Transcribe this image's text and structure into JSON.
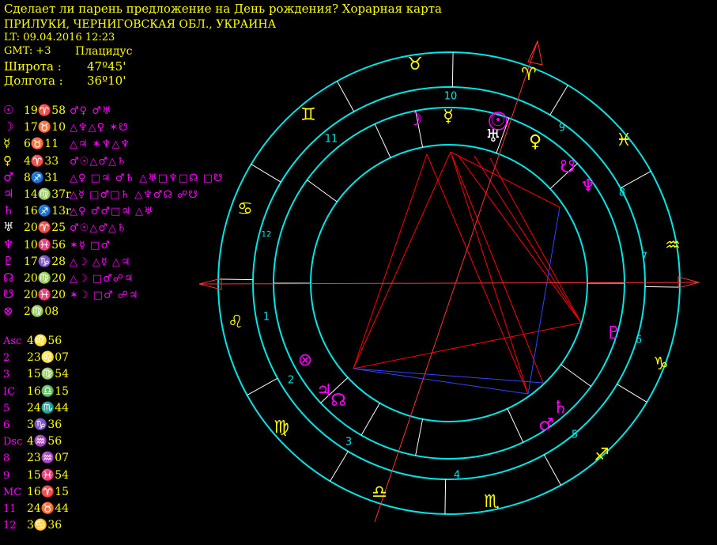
{
  "header": {
    "title": "Сделает ли парень предложение на День рождения? Хорарная карта",
    "place": "ПРИЛУКИ, ЧЕРНИГОВСКАЯ ОБЛ., УКРАИНА",
    "lt": "LT: 09.04.2016  12:23",
    "gmt": "GMT: +3",
    "house_system": "Плацидус",
    "lat_label": "Широта :",
    "lat_value": "47º45'",
    "lon_label": "Долгота :",
    "lon_value": "36º10'"
  },
  "colors": {
    "background": "#000000",
    "wheel": "#00e5e5",
    "house_number": "#00e5e5",
    "sign_glyph": "#ffff00",
    "planet_magenta": "#ff00ff",
    "planet_yellow": "#ffff00",
    "aspect_red": "#ff0000",
    "aspect_blue": "#3344ff"
  },
  "planets": [
    {
      "glyph": "☉",
      "color": "#ff00ff",
      "pos": "19♈58",
      "aspects": "♂♀ ♂♅"
    },
    {
      "glyph": "☽",
      "color": "#ff00ff",
      "pos": "17♉10",
      "aspects": "△♆△♀ ✶☋"
    },
    {
      "glyph": "☿",
      "color": "#ffff00",
      "pos": "6♉11",
      "aspects": "△♃ ✶♆△♆"
    },
    {
      "glyph": "♀",
      "color": "#ffff00",
      "pos": "4♈33",
      "aspects": "♂☉△♂△♄"
    },
    {
      "glyph": "♂",
      "color": "#ff00ff",
      "pos": "8♐31",
      "aspects": "△♀ □♃ ♂♄ △♅□♆□☊ □☋"
    },
    {
      "glyph": "♃",
      "color": "#ff00ff",
      "pos": "14♍37r",
      "aspects": "△☿ □♂□♄ △♆♂☊ ☍☋"
    },
    {
      "glyph": "♄",
      "color": "#ff00ff",
      "pos": "16♐13r",
      "aspects": "△♀ ♂♂□♃ △♅"
    },
    {
      "glyph": "♅",
      "color": "#ffffff",
      "pos": "20♈25",
      "aspects": "♂☉△♂△♄"
    },
    {
      "glyph": "♆",
      "color": "#ff00ff",
      "pos": "10♓56",
      "aspects": "✶☿ □♂"
    },
    {
      "glyph": "♇",
      "color": "#ff00ff",
      "pos": "17♑28",
      "aspects": "△☽ △☿ △♃"
    },
    {
      "glyph": "☊",
      "color": "#ff00ff",
      "pos": "20♍20",
      "aspects": "△☽ □♂☍♃"
    },
    {
      "glyph": "☋",
      "color": "#ff00ff",
      "pos": "20♓20",
      "aspects": "✶☽ □♂ ☍♃"
    },
    {
      "glyph": "⊗",
      "color": "#ff00ff",
      "pos": "2♍08",
      "aspects": ""
    }
  ],
  "cusps": [
    {
      "label": "Asc",
      "color": "#ff00ff",
      "pos": "4♌56"
    },
    {
      "label": "2",
      "color": "#ff00ff",
      "pos": "23♌07"
    },
    {
      "label": "3",
      "color": "#ff00ff",
      "pos": "15♍54"
    },
    {
      "label": "IC",
      "color": "#ff00ff",
      "pos": "16♎15"
    },
    {
      "label": "5",
      "color": "#ff00ff",
      "pos": "24♏44"
    },
    {
      "label": "6",
      "color": "#ff00ff",
      "pos": "3♑36"
    },
    {
      "label": "Dsc",
      "color": "#ff00ff",
      "pos": "4♒56"
    },
    {
      "label": "8",
      "color": "#ff00ff",
      "pos": "23♒07"
    },
    {
      "label": "9",
      "color": "#ff00ff",
      "pos": "15♓54"
    },
    {
      "label": "MC",
      "color": "#ff00ff",
      "pos": "16♈15"
    },
    {
      "label": "11",
      "color": "#ff00ff",
      "pos": "24♉44"
    },
    {
      "label": "12",
      "color": "#ff00ff",
      "pos": "3♋36"
    }
  ],
  "wheel": {
    "signs": [
      {
        "glyph": "♉",
        "name": "taurus"
      },
      {
        "glyph": "♈",
        "name": "aries"
      },
      {
        "glyph": "♓",
        "name": "pisces"
      },
      {
        "glyph": "♒",
        "name": "aquarius"
      },
      {
        "glyph": "♑",
        "name": "capricorn"
      },
      {
        "glyph": "♐",
        "name": "sagittarius"
      },
      {
        "glyph": "♏",
        "name": "scorpio"
      },
      {
        "glyph": "♎",
        "name": "libra"
      },
      {
        "glyph": "♍",
        "name": "virgo"
      },
      {
        "glyph": "♌",
        "name": "leo"
      },
      {
        "glyph": "♋",
        "name": "cancer"
      },
      {
        "glyph": "♊",
        "name": "gemini"
      }
    ],
    "house_numbers": [
      "10",
      "9",
      "8",
      "7",
      "6",
      "5",
      "4",
      "3",
      "2",
      "1",
      "12",
      "11"
    ],
    "planet_glyphs": [
      {
        "glyph": "☽",
        "color": "#ff00ff"
      },
      {
        "glyph": "☿",
        "color": "#ffff00"
      },
      {
        "glyph": "☉",
        "color": "#ff00ff"
      },
      {
        "glyph": "♅",
        "color": "#ffffff"
      },
      {
        "glyph": "♀",
        "color": "#ffff00"
      },
      {
        "glyph": "☋",
        "color": "#ff00ff"
      },
      {
        "glyph": "♆",
        "color": "#ff00ff"
      },
      {
        "glyph": "♇",
        "color": "#ff00ff"
      },
      {
        "glyph": "♄",
        "color": "#ff00ff"
      },
      {
        "glyph": "♂",
        "color": "#ff00ff"
      },
      {
        "glyph": "♃",
        "color": "#ff00ff"
      },
      {
        "glyph": "☊",
        "color": "#ff00ff"
      },
      {
        "glyph": "⊗",
        "color": "#ff00ff"
      }
    ]
  }
}
